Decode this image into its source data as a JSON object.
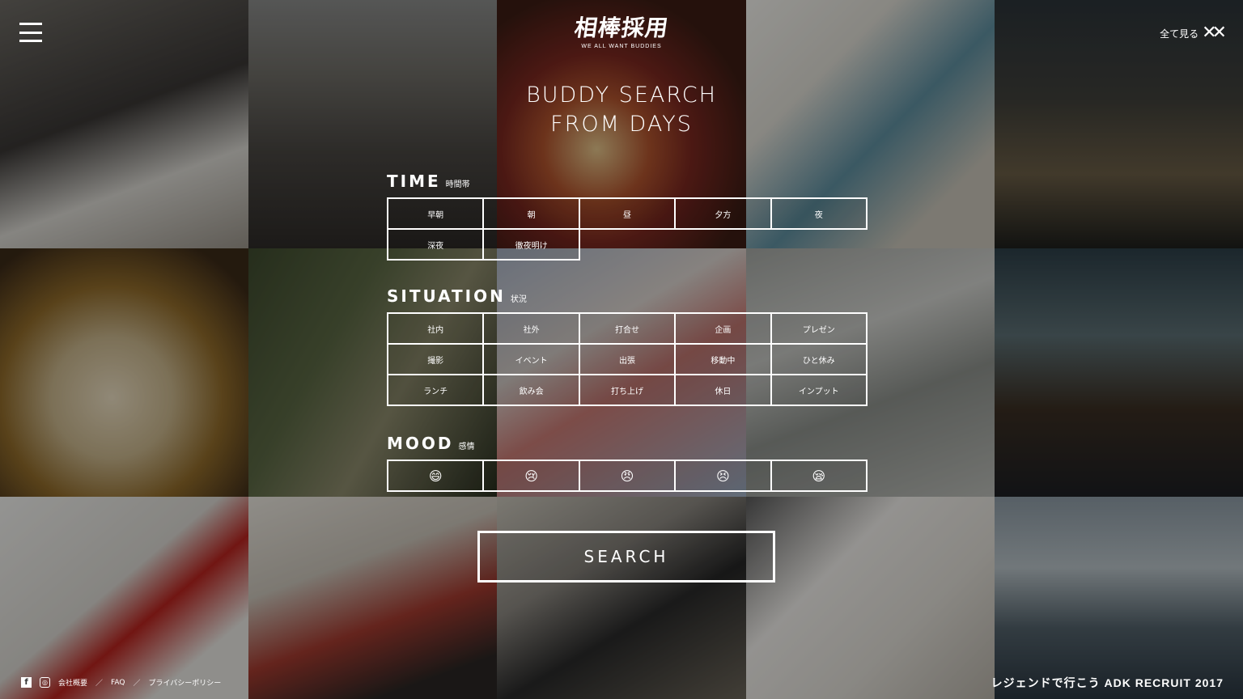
{
  "header": {
    "logo_mark": "相棒採用",
    "logo_sub": "WE ALL WANT BUDDIES",
    "view_all_label": "全て見る",
    "view_all_icon": "✕✕"
  },
  "hero": {
    "title_line1": "BUDDY SEARCH",
    "title_line2": "FROM DAYS"
  },
  "time": {
    "label_en": "TIME",
    "label_ja": "時間帯",
    "options": [
      "早朝",
      "朝",
      "昼",
      "夕方",
      "夜",
      "深夜",
      "徹夜明け"
    ]
  },
  "situation": {
    "label_en": "SITUATION",
    "label_ja": "状況",
    "options": [
      "社内",
      "社外",
      "打合せ",
      "企画",
      "プレゼン",
      "撮影",
      "イベント",
      "出張",
      "移動中",
      "ひと休み",
      "ランチ",
      "飲み会",
      "打ち上げ",
      "休日",
      "インプット"
    ]
  },
  "mood": {
    "label_en": "MOOD",
    "label_ja": "感情",
    "options": [
      "😄",
      "😢",
      "😠",
      "😣",
      "😪"
    ]
  },
  "search": {
    "label": "SEARCH"
  },
  "footer": {
    "facebook_icon": "f",
    "instagram_icon": "◎",
    "links": [
      "会社概要",
      "FAQ",
      "プライバシーポリシー"
    ],
    "separator": "／",
    "tagline": "レジェンドで行こう ADK RECRUIT 2017"
  }
}
